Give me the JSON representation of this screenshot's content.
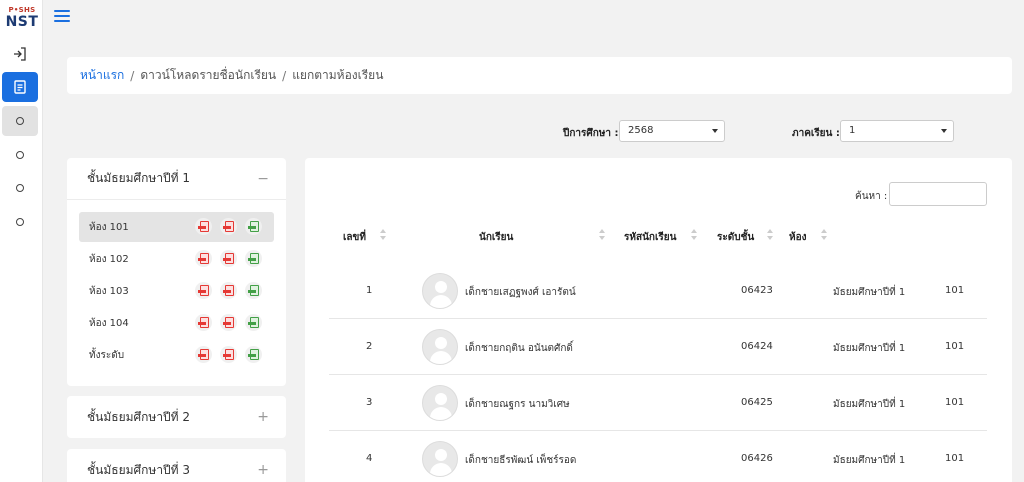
{
  "app": {
    "logo_top": "P•SHS",
    "logo_main": "NST"
  },
  "breadcrumb": {
    "home": "หน้าแรก",
    "level2": "ดาวน์โหลดรายชื่อนักเรียน",
    "level3": "แยกตามห้องเรียน",
    "separator": "/"
  },
  "filters": {
    "year_label": "ปีการศึกษา :",
    "year_value": "2568",
    "term_label": "ภาคเรียน :",
    "term_value": "1"
  },
  "grades": [
    {
      "title": "ชั้นมัธยมศึกษาปีที่ 1",
      "toggle": "−",
      "expanded": true
    },
    {
      "title": "ชั้นมัธยมศึกษาปีที่ 2",
      "toggle": "+",
      "expanded": false
    },
    {
      "title": "ชั้นมัธยมศึกษาปีที่ 3",
      "toggle": "+",
      "expanded": false
    }
  ],
  "rooms": [
    {
      "label": "ห้อง 101",
      "selected": true
    },
    {
      "label": "ห้อง 102",
      "selected": false
    },
    {
      "label": "ห้อง 103",
      "selected": false
    },
    {
      "label": "ห้อง 104",
      "selected": false
    },
    {
      "label": "ทั้งระดับ",
      "selected": false
    }
  ],
  "table": {
    "search_label": "ค้นหา :",
    "search_value": "",
    "headers": {
      "no": "เลขที่",
      "student": "นักเรียน",
      "student_id": "รหัสนักเรียน",
      "grade": "ระดับชั้น",
      "room": "ห้อง"
    },
    "rows": [
      {
        "no": "1",
        "name": "เด็กชายเสฏฐพงศ์ เอารัตน์",
        "student_id": "06423",
        "grade": "มัธยมศึกษาปีที่ 1",
        "room": "101"
      },
      {
        "no": "2",
        "name": "เด็กชายกฤติน อนันตศักดิ์",
        "student_id": "06424",
        "grade": "มัธยมศึกษาปีที่ 1",
        "room": "101"
      },
      {
        "no": "3",
        "name": "เด็กชายณฐกร นามวิเศษ",
        "student_id": "06425",
        "grade": "มัธยมศึกษาปีที่ 1",
        "room": "101"
      },
      {
        "no": "4",
        "name": "เด็กชายธีรพัฒน์ เพ็ชร์รอด",
        "student_id": "06426",
        "grade": "มัธยมศึกษาปีที่ 1",
        "room": "101"
      }
    ]
  },
  "colors": {
    "accent": "#1a6fe0",
    "pdf": "#e53935",
    "excel": "#43a047"
  }
}
